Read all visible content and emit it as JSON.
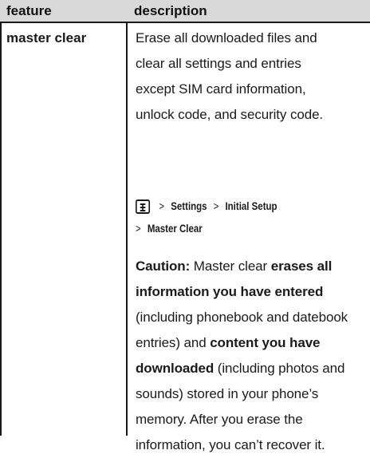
{
  "table": {
    "headers": {
      "feature": "feature",
      "description": "description"
    },
    "row": {
      "feature": "master clear",
      "intro_lines": [
        "Erase all downloaded files and",
        "clear all settings and entries",
        "except SIM card information,",
        "unlock code, and security code."
      ],
      "path": {
        "key_icon": "menu-key-icon",
        "sep": ">",
        "line1_items": [
          "Settings",
          "Initial Setup"
        ],
        "line2_items": [
          "Master Clear"
        ]
      },
      "caution": [
        {
          "text": "Caution:",
          "bold": true
        },
        {
          "text": " Master clear ",
          "bold": false
        },
        {
          "text": "erases all information you have entered",
          "bold": true
        },
        {
          "text": " (including phonebook and datebook entries) and ",
          "bold": false
        },
        {
          "text": "content you have downloaded",
          "bold": true
        },
        {
          "text": " (including photos and sounds) stored in your phone’s memory. After you erase the information, you can’t recover it.",
          "bold": false
        }
      ]
    }
  },
  "colors": {
    "header_background": "#d9d9d9",
    "rule": "#1a1a1a",
    "text": "#1a1a1a"
  }
}
